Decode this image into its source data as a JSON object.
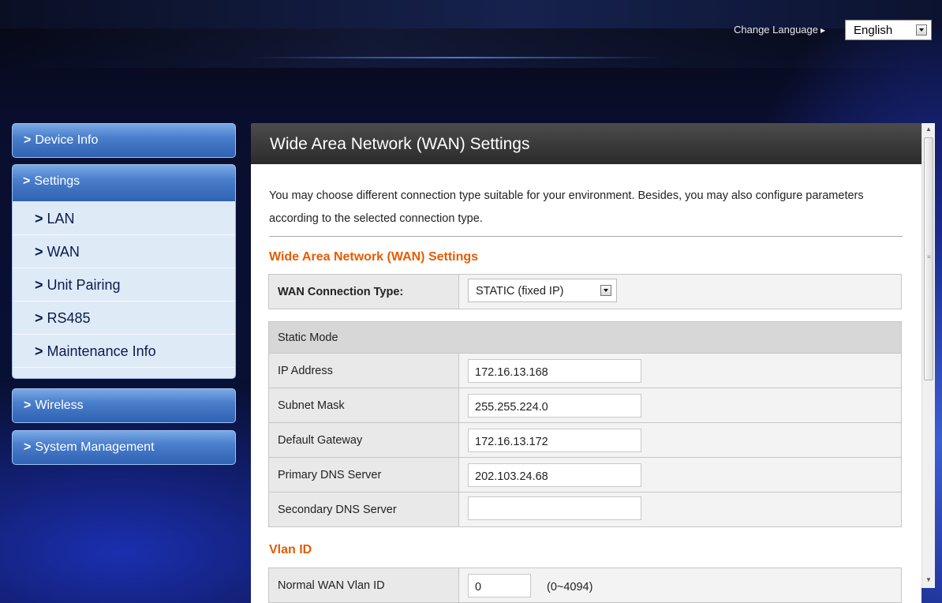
{
  "header": {
    "change_language_label": "Change Language",
    "language_value": "English"
  },
  "sidebar": {
    "device_info": "Device Info",
    "settings": "Settings",
    "settings_items": [
      "LAN",
      "WAN",
      "Unit Pairing",
      "RS485",
      "Maintenance Info"
    ],
    "wireless": "Wireless",
    "system_management": "System Management"
  },
  "main": {
    "title": "Wide Area Network (WAN) Settings",
    "intro": "You may choose different connection type suitable for your environment. Besides, you may also configure parameters according to the selected connection type.",
    "section_title": "Wide Area Network (WAN) Settings",
    "connection_type_label": "WAN Connection Type:",
    "connection_type_value": "STATIC (fixed IP)",
    "static_mode_label": "Static Mode",
    "fields": [
      {
        "label": "IP Address",
        "value": "172.16.13.168"
      },
      {
        "label": "Subnet Mask",
        "value": "255.255.224.0"
      },
      {
        "label": "Default Gateway",
        "value": "172.16.13.172"
      },
      {
        "label": "Primary DNS Server",
        "value": "202.103.24.68"
      },
      {
        "label": "Secondary DNS Server",
        "value": ""
      }
    ],
    "vlan_title": "Vlan ID",
    "vlan_label": "Normal WAN Vlan ID",
    "vlan_value": "0",
    "vlan_range": "(0~4094)"
  },
  "colors": {
    "accent_orange": "#e65c00",
    "menu_blue": "#4a7fcc",
    "header_dark": "#2b2b2b"
  }
}
